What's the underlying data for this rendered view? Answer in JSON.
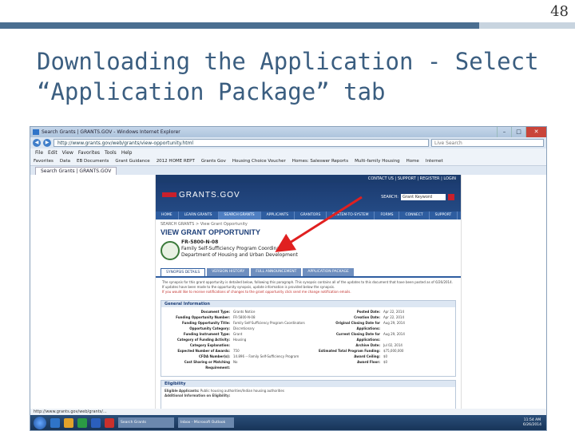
{
  "slide": {
    "number": "48",
    "title": "Downloading the Application - Select “Application Package” tab"
  },
  "browser": {
    "window_title": "Search Grants | GRANTS.GOV - Windows Internet Explorer",
    "address": "http://www.grants.gov/web/grants/view-opportunity.html",
    "search_placeholder": "Live Search",
    "menu": [
      "File",
      "Edit",
      "View",
      "Favorites",
      "Tools",
      "Help"
    ],
    "favorites": [
      "Favorites",
      "Data",
      "EB Documents",
      "Grant Guidance",
      "2012 HOME REPT",
      "Grants Gov",
      "Housing Choice Voucher",
      "Homes: Saleswer Reports",
      "Multi-family Housing",
      "Home",
      "Internet"
    ],
    "tab": "Search Grants | GRANTS.GOV"
  },
  "site": {
    "top_links": "CONTACT US  |  SUPPORT  |  REGISTER  |  LOGIN",
    "logo": "GRANTS.GOV",
    "search_label": "SEARCH:",
    "search_value": "Grant Keyword",
    "nav": [
      "HOME",
      "LEARN GRANTS",
      "SEARCH GRANTS",
      "APPLICANTS",
      "GRANTORS",
      "SYSTEM-TO-SYSTEM",
      "FORMS",
      "CONNECT",
      "SUPPORT"
    ],
    "breadcrumb": "SEARCH GRANTS  >  View Grant Opportunity",
    "page_title": "VIEW GRANT OPPORTUNITY",
    "opportunity": {
      "number": "FR-5800-N-08",
      "title": "Family Self-Sufficiency Program Coordinators",
      "agency": "Department of Housing and Urban Development"
    },
    "tabs": [
      "SYNOPSIS DETAILS",
      "VERSION HISTORY",
      "FULL ANNOUNCEMENT",
      "APPLICATION PACKAGE"
    ],
    "intro": "The synopsis for this grant opportunity is detailed below, following this paragraph. This synopsis contains all of the updates to this document that have been posted as of 6/26/2014. If updates have been made to the opportunity synopsis, update information is provided below the synopsis.",
    "intro_red": "If you would like to receive notifications of changes to the grant opportunity click send me change notification emails.",
    "general_header": "General Information",
    "general_left": [
      {
        "k": "Document Type:",
        "v": "Grants Notice"
      },
      {
        "k": "Funding Opportunity Number:",
        "v": "FR-5800-N-08"
      },
      {
        "k": "Funding Opportunity Title:",
        "v": "Family Self-Sufficiency Program Coordinators"
      },
      {
        "k": "Opportunity Category:",
        "v": "Discretionary"
      },
      {
        "k": "Funding Instrument Type:",
        "v": "Grant"
      },
      {
        "k": "Category of Funding Activity:",
        "v": "Housing"
      },
      {
        "k": "Category Explanation:",
        "v": ""
      },
      {
        "k": "Expected Number of Awards:",
        "v": "750"
      },
      {
        "k": "CFDA Number(s):",
        "v": "14.896 -- Family Self-Sufficiency Program"
      },
      {
        "k": "Cost Sharing or Matching Requirement:",
        "v": "No"
      }
    ],
    "general_right": [
      {
        "k": "Posted Date:",
        "v": "Apr 22, 2014"
      },
      {
        "k": "Creation Date:",
        "v": "Apr 22, 2014"
      },
      {
        "k": "Original Closing Date for Applications:",
        "v": "Aug 29, 2014"
      },
      {
        "k": "Current Closing Date for Applications:",
        "v": "Aug 29, 2014"
      },
      {
        "k": "Archive Date:",
        "v": "Jul 02, 2014"
      },
      {
        "k": "Estimated Total Program Funding:",
        "v": "$75,000,000"
      },
      {
        "k": "Award Ceiling:",
        "v": "$0"
      },
      {
        "k": "Award Floor:",
        "v": "$0"
      }
    ],
    "eligibility_header": "Eligibility",
    "eligible_label": "Eligible Applicants:",
    "eligible_value": "Public housing authorities/Indian housing authorities",
    "eligible_info": "Additional Information on Eligibility:"
  },
  "status_bar": "http://www.grants.gov/web/grants/...",
  "taskbar": {
    "tasks": [
      "Search Grants",
      "Inbox - Microsoft Outlook"
    ],
    "clock_time": "11:54 AM",
    "clock_date": "6/26/2014"
  },
  "colors": {
    "slide_title": "#3b5e80",
    "site_header": "#1c3c71",
    "arrow": "#e02020"
  }
}
